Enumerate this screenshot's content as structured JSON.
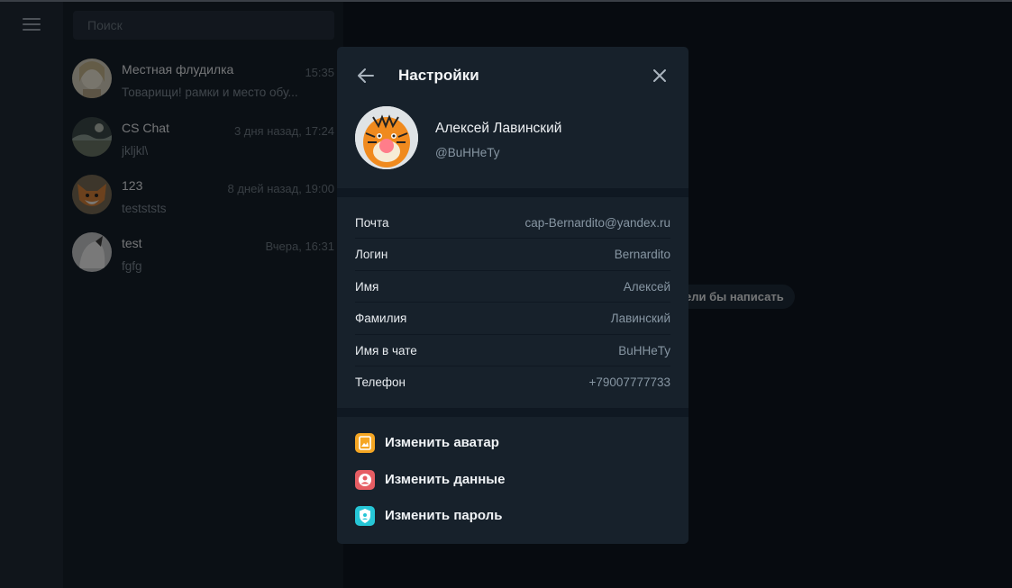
{
  "search": {
    "placeholder": "Поиск"
  },
  "chats": [
    {
      "name": "Местная флудилка",
      "time": "15:35",
      "snippet": "Товарищи! рамки и место обу..."
    },
    {
      "name": "CS Chat",
      "time": "3 дня назад, 17:24",
      "snippet": "jkljkl\\"
    },
    {
      "name": "123",
      "time": "8 дней назад, 19:00",
      "snippet": "testststs"
    },
    {
      "name": "test",
      "time": "Вчера, 16:31",
      "snippet": "fgfg"
    }
  ],
  "main": {
    "hint": "ели бы написать"
  },
  "settings": {
    "title": "Настройки",
    "profile": {
      "name": "Алексей Лавинский",
      "username": "@BuHHeTy"
    },
    "fields": [
      {
        "label": "Почта",
        "value": "cap-Bernardito@yandex.ru"
      },
      {
        "label": "Логин",
        "value": "Bernardito"
      },
      {
        "label": "Имя",
        "value": "Алексей"
      },
      {
        "label": "Фамилия",
        "value": "Лавинский"
      },
      {
        "label": "Имя в чате",
        "value": "BuHHeTy"
      },
      {
        "label": "Телефон",
        "value": "+79007777733"
      }
    ],
    "actions": [
      {
        "label": "Изменить аватар",
        "icon": "image-icon",
        "color": "#f5a623"
      },
      {
        "label": "Изменить данные",
        "icon": "user-icon",
        "color": "#e65d63"
      },
      {
        "label": "Изменить пароль",
        "icon": "shield-icon",
        "color": "#26c6d6"
      }
    ]
  }
}
